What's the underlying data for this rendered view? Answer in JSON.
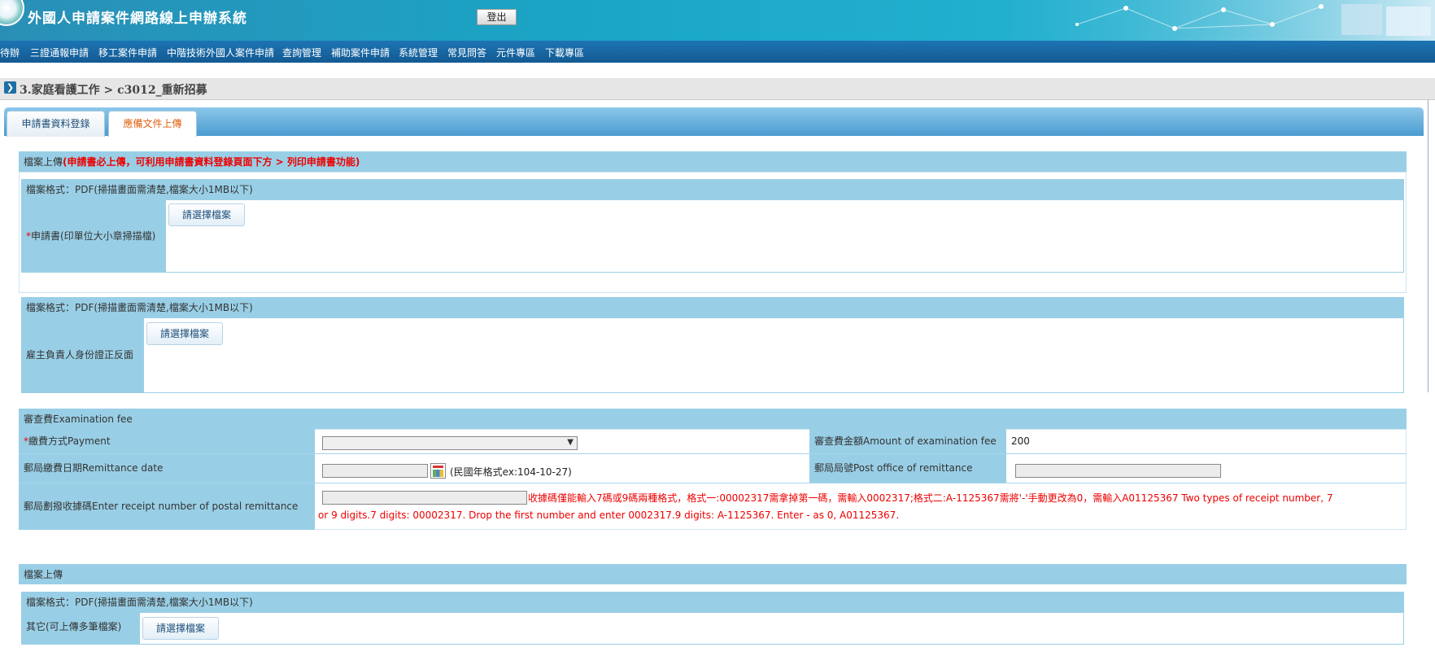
{
  "header": {
    "title": "外國人申請案件網路線上申辦系統",
    "logout_label": "登出",
    "colors": {
      "header": "#1aa5c6",
      "menubar": "#135a93",
      "label_bg": "#99cfe6",
      "required": "#e00000"
    }
  },
  "menu": {
    "items": [
      "待辦",
      "三證通報申請",
      "移工案件申請",
      "中階技術外國人案件申請",
      "查詢管理",
      "補助案件申請",
      "系統管理",
      "常見問答",
      "元件專區",
      "下載專區"
    ]
  },
  "breadcrumb": {
    "icon": "chevron-right-icon",
    "text": "3.家庭看護工作 > c3012_重新招募"
  },
  "tabs": [
    {
      "label": "申請書資料登錄"
    },
    {
      "label": "應備文件上傳"
    }
  ],
  "upload_section_1": {
    "title_prefix": "檔案上傳",
    "title_note": "(申請書必上傳，可利用申請書資料登錄頁面下方 > 列印申請書功能)",
    "item1": {
      "format": "檔案格式：PDF(掃描畫面需清楚,檔案大小1MB以下)",
      "required_mark": "*",
      "label": "申請書(印單位大小章掃描檔)",
      "button": "請選擇檔案"
    },
    "item2": {
      "format": "檔案格式：PDF(掃描畫面需清楚,檔案大小1MB以下)",
      "label": "雇主負責人身份證正反面",
      "button": "請選擇檔案"
    }
  },
  "fee": {
    "title": "審查費Examination fee",
    "payment_required": "*",
    "payment_label": "繳費方式Payment",
    "payment_value": "",
    "amount_label": "審查費金額Amount of examination fee",
    "amount_value": "200",
    "date_label": "郵局繳費日期Remittance date",
    "date_value": "",
    "date_hint": "(民國年格式ex:104-10-27)",
    "post_office_label": "郵局局號Post office of remittance",
    "post_office_value": "",
    "receipt_label": "郵局劃撥收據碼Enter receipt number of postal remittance",
    "receipt_value": "",
    "receipt_hint_line1": "收據碼僅能輸入7碼或9碼兩種格式，格式一:00002317需拿掉第一碼，需輸入0002317;格式二:A-1125367需將'-'手動更改為0，需輸入A01125367 Two types of receipt number, 7",
    "receipt_hint_line2": "or 9 digits.7 digits: 00002317. Drop the first number and enter 0002317.9 digits: A-1125367. Enter - as 0, A01125367."
  },
  "upload_section_2": {
    "title": "檔案上傳",
    "format": "檔案格式：PDF(掃描畫面需清楚,檔案大小1MB以下)",
    "label": "其它(可上傳多筆檔案)",
    "button": "請選擇檔案"
  }
}
